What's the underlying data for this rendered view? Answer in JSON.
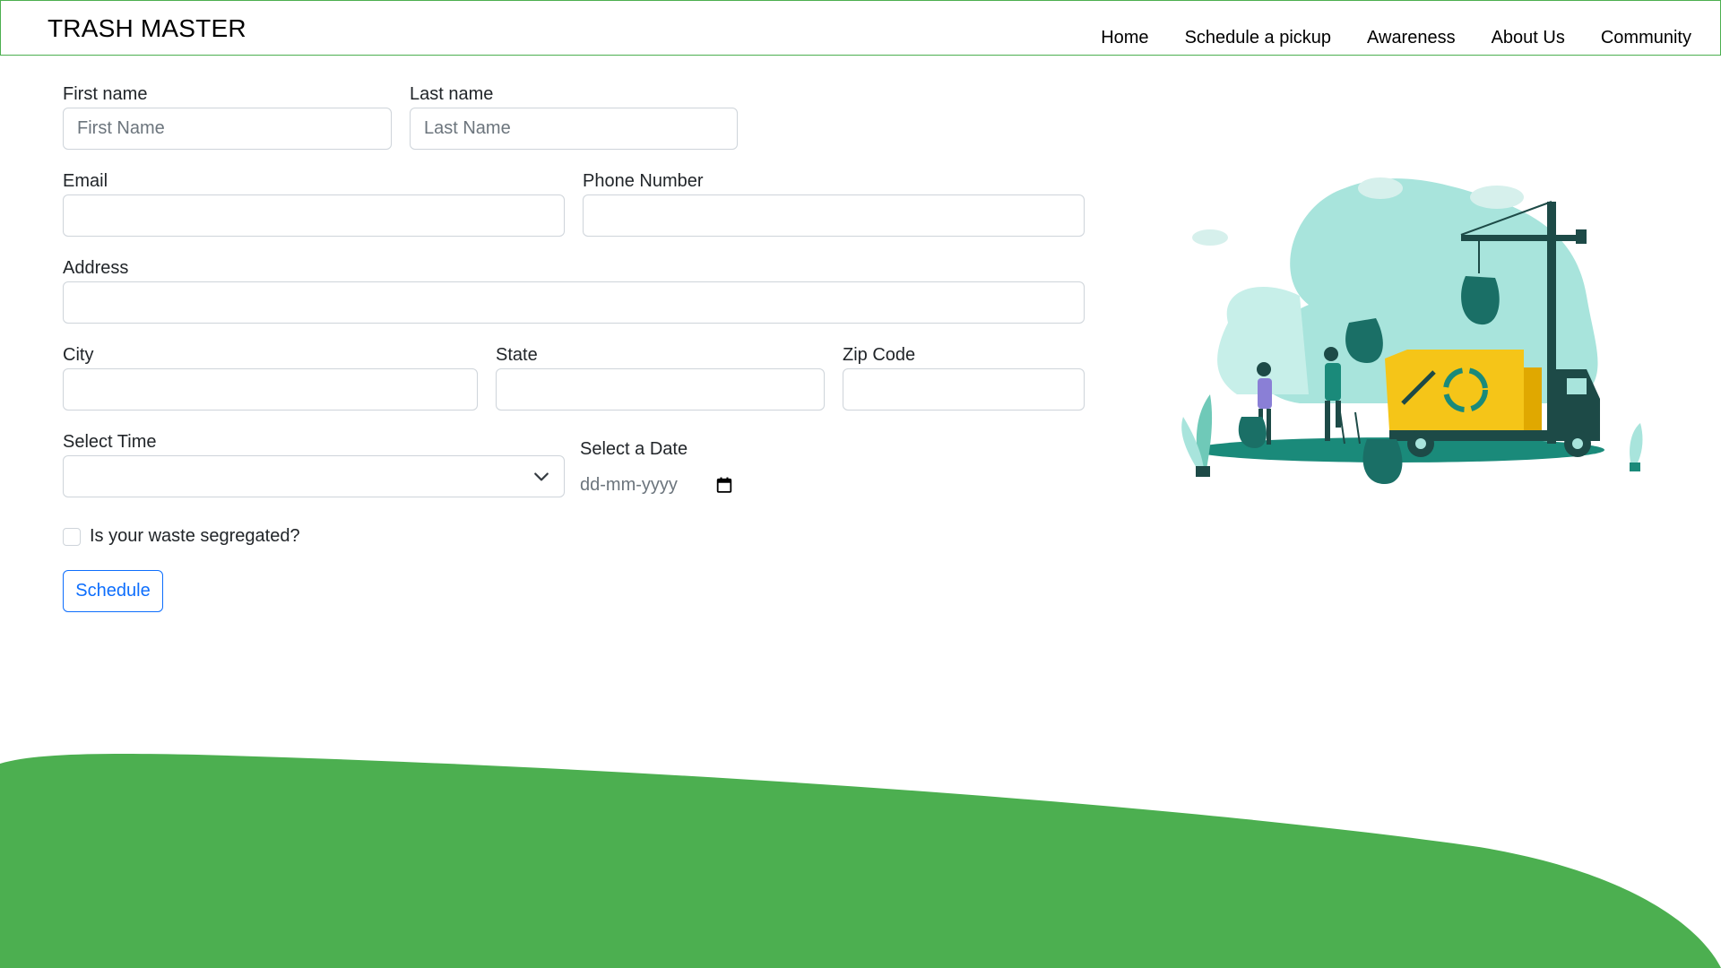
{
  "brand": "TRASH MASTER",
  "nav": [
    "Home",
    "Schedule a pickup",
    "Awareness",
    "About Us",
    "Community"
  ],
  "form": {
    "first_name_label": "First name",
    "first_name_placeholder": "First Name",
    "last_name_label": "Last name",
    "last_name_placeholder": "Last Name",
    "email_label": "Email",
    "phone_label": "Phone Number",
    "address_label": "Address",
    "city_label": "City",
    "state_label": "State",
    "zip_label": "Zip Code",
    "time_label": "Select Time",
    "time_value": "",
    "date_label": "Select a Date",
    "date_placeholder": "dd-mm-yyyy",
    "segregated_label": "Is your waste segregated?",
    "segregated_checked": false,
    "submit_label": "Schedule"
  },
  "colors": {
    "accent_green": "#4caf50",
    "primary_blue": "#0d6efd",
    "teal": "#1a8a7a",
    "truck_yellow": "#f5c518"
  },
  "icons": [
    "chevron-down-icon",
    "calendar-icon"
  ],
  "illustration": "garbage-truck-recycling-illustration"
}
